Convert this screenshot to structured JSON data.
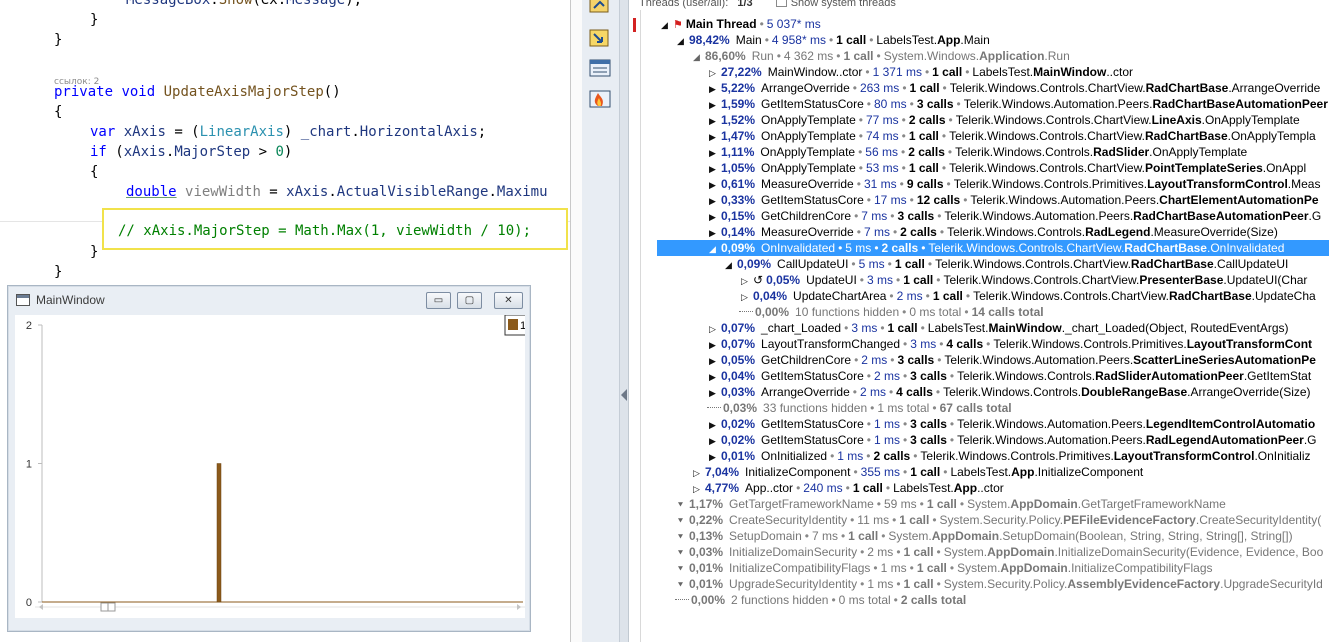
{
  "editor": {
    "lines": [
      {
        "parts": [
          {
            "c": "id",
            "t": "MessageBox"
          },
          {
            "c": "",
            "t": "."
          },
          {
            "c": "mt",
            "t": "Show"
          },
          {
            "c": "",
            "t": "(ex."
          },
          {
            "c": "id",
            "t": "Message"
          },
          {
            "c": "",
            "t": ");"
          }
        ]
      },
      {
        "parts": [
          {
            "c": "",
            "t": "}"
          }
        ]
      },
      {
        "parts": [
          {
            "c": "",
            "t": "}"
          }
        ]
      },
      {
        "parts": [
          {
            "c": "ref",
            "t": "ссылок: 2"
          }
        ]
      },
      {
        "parts": [
          {
            "c": "kw",
            "t": "private"
          },
          {
            "c": "",
            "t": " "
          },
          {
            "c": "kw",
            "t": "void"
          },
          {
            "c": "",
            "t": " "
          },
          {
            "c": "mt",
            "t": "UpdateAxisMajorStep"
          },
          {
            "c": "",
            "t": "()"
          }
        ]
      },
      {
        "parts": [
          {
            "c": "",
            "t": "{"
          }
        ]
      },
      {
        "parts": [
          {
            "c": "kw",
            "t": "var"
          },
          {
            "c": "",
            "t": " "
          },
          {
            "c": "id",
            "t": "xAxis"
          },
          {
            "c": "",
            "t": " = ("
          },
          {
            "c": "ty",
            "t": "LinearAxis"
          },
          {
            "c": "",
            "t": ") "
          },
          {
            "c": "id",
            "t": "_chart"
          },
          {
            "c": "",
            "t": "."
          },
          {
            "c": "id",
            "t": "HorizontalAxis"
          },
          {
            "c": "",
            "t": ";"
          }
        ]
      },
      {
        "parts": [
          {
            "c": "kw",
            "t": "if"
          },
          {
            "c": "",
            "t": " ("
          },
          {
            "c": "id",
            "t": "xAxis"
          },
          {
            "c": "",
            "t": "."
          },
          {
            "c": "id",
            "t": "MajorStep"
          },
          {
            "c": "",
            "t": " > "
          },
          {
            "c": "nu",
            "t": "0"
          },
          {
            "c": "",
            "t": ")"
          }
        ]
      },
      {
        "parts": [
          {
            "c": "",
            "t": "{"
          }
        ]
      },
      {
        "parts": [
          {
            "c": "kw uline",
            "t": "double"
          },
          {
            "c": "",
            "t": " "
          },
          {
            "c": "dim",
            "t": "viewWidth"
          },
          {
            "c": "",
            "t": " = "
          },
          {
            "c": "id",
            "t": "xAxis"
          },
          {
            "c": "",
            "t": "."
          },
          {
            "c": "id",
            "t": "ActualVisibleRange"
          },
          {
            "c": "",
            "t": "."
          },
          {
            "c": "id",
            "t": "Maximu"
          }
        ]
      },
      {
        "parts": [
          {
            "c": "cm",
            "t": "// xAxis.MajorStep = Math.Max(1, viewWidth / 10);"
          }
        ]
      },
      {
        "parts": [
          {
            "c": "",
            "t": "}"
          }
        ]
      },
      {
        "parts": [
          {
            "c": "",
            "t": "}"
          }
        ]
      }
    ]
  },
  "main_window": {
    "title": "MainWindow",
    "min_glyph": "▭",
    "max_glyph": "▢",
    "close_glyph": "✕",
    "legend_label": "1",
    "accent": "#8b5a1b"
  },
  "chart_data": {
    "type": "bar",
    "categories": [
      ""
    ],
    "values": [
      1
    ],
    "yticks": [
      "0",
      "1",
      "2"
    ],
    "ylim": [
      0,
      2
    ],
    "legend": [
      "1"
    ]
  },
  "profiler": {
    "threads_label": "Threads (user/all):",
    "threads_value": "1/3",
    "show_system_threads": "Show system threads",
    "main_thread": {
      "name": "Main Thread",
      "time": "5 037* ms"
    },
    "rows": [
      {
        "tog": "◢",
        "pct": "98,42%",
        "method": "Main",
        "time": "4 958* ms",
        "calls": "1 call",
        "ns": "LabelsTest.",
        "cls": "App",
        "rest": ".Main"
      },
      {
        "tog": "◢",
        "pct": "86,60%",
        "method": "Run",
        "time": "4 362 ms",
        "calls": "1 call",
        "ns": "System.Windows.",
        "cls": "Application",
        "rest": ".Run",
        "gray": true
      },
      {
        "tog": "▷",
        "pct": "27,22%",
        "method": "MainWindow..ctor",
        "time": "1 371 ms",
        "calls": "1 call",
        "ns": "LabelsTest.",
        "cls": "MainWindow",
        "rest": "..ctor"
      },
      {
        "tog": "▶",
        "pct": "5,22%",
        "method": "ArrangeOverride",
        "time": "263 ms",
        "calls": "1 call",
        "ns": "Telerik.Windows.Controls.ChartView.",
        "cls": "RadChartBase",
        "rest": ".ArrangeOverride"
      },
      {
        "tog": "▶",
        "pct": "1,59%",
        "method": "GetItemStatusCore",
        "time": "80 ms",
        "calls": "3 calls",
        "ns": "Telerik.Windows.Automation.Peers.",
        "cls": "RadChartBaseAutomationPeer",
        "rest": ""
      },
      {
        "tog": "▶",
        "pct": "1,52%",
        "method": "OnApplyTemplate",
        "time": "77 ms",
        "calls": "2 calls",
        "ns": "Telerik.Windows.Controls.ChartView.",
        "cls": "LineAxis",
        "rest": ".OnApplyTemplate"
      },
      {
        "tog": "▶",
        "pct": "1,47%",
        "method": "OnApplyTemplate",
        "time": "74 ms",
        "calls": "1 call",
        "ns": "Telerik.Windows.Controls.ChartView.",
        "cls": "RadChartBase",
        "rest": ".OnApplyTempla"
      },
      {
        "tog": "▶",
        "pct": "1,11%",
        "method": "OnApplyTemplate",
        "time": "56 ms",
        "calls": "2 calls",
        "ns": "Telerik.Windows.Controls.",
        "cls": "RadSlider",
        "rest": ".OnApplyTemplate"
      },
      {
        "tog": "▶",
        "pct": "1,05%",
        "method": "OnApplyTemplate",
        "time": "53 ms",
        "calls": "1 call",
        "ns": "Telerik.Windows.Controls.ChartView.",
        "cls": "PointTemplateSeries",
        "rest": ".OnAppl"
      },
      {
        "tog": "▶",
        "pct": "0,61%",
        "method": "MeasureOverride",
        "time": "31 ms",
        "calls": "9 calls",
        "ns": "Telerik.Windows.Controls.Primitives.",
        "cls": "LayoutTransformControl",
        "rest": ".Meas"
      },
      {
        "tog": "▶",
        "pct": "0,33%",
        "method": "GetItemStatusCore",
        "time": "17 ms",
        "calls": "12 calls",
        "ns": "Telerik.Windows.Automation.Peers.",
        "cls": "ChartElementAutomationPe",
        "rest": ""
      },
      {
        "tog": "▶",
        "pct": "0,15%",
        "method": "GetChildrenCore",
        "time": "7 ms",
        "calls": "3 calls",
        "ns": "Telerik.Windows.Automation.Peers.",
        "cls": "RadChartBaseAutomationPeer",
        "rest": ".G"
      },
      {
        "tog": "▶",
        "pct": "0,14%",
        "method": "MeasureOverride",
        "time": "7 ms",
        "calls": "2 calls",
        "ns": "Telerik.Windows.Controls.",
        "cls": "RadLegend",
        "rest": ".MeasureOverride(Size)"
      },
      {
        "tog": "◢",
        "pct": "0,09%",
        "method": "OnInvalidated",
        "time": "5 ms",
        "calls": "2 calls",
        "ns": "Telerik.Windows.Controls.ChartView.",
        "cls": "RadChartBase",
        "rest": ".OnInvalidated",
        "sel": true
      },
      {
        "tog": "◢",
        "pct": "0,09%",
        "method": "CallUpdateUI",
        "time": "5 ms",
        "calls": "1 call",
        "ns": "Telerik.Windows.Controls.ChartView.",
        "cls": "RadChartBase",
        "rest": ".CallUpdateUI"
      },
      {
        "tog": "▷",
        "pre": "↺",
        "pct": "0,05%",
        "method": "UpdateUI",
        "time": "3 ms",
        "calls": "1 call",
        "ns": "Telerik.Windows.Controls.ChartView.",
        "cls": "PresenterBase",
        "rest": ".UpdateUI(Char"
      },
      {
        "tog": "▷",
        "pct": "0,04%",
        "method": "UpdateChartArea",
        "time": "2 ms",
        "calls": "1 call",
        "ns": "Telerik.Windows.Controls.ChartView.",
        "cls": "RadChartBase",
        "rest": ".UpdateCha"
      },
      {
        "tog": "",
        "dots": true,
        "pct": "0,00%",
        "method": "10 functions hidden",
        "time": "0 ms total",
        "calls": "14 calls total",
        "gray": true
      },
      {
        "tog": "▷",
        "pct": "0,07%",
        "method": "_chart_Loaded",
        "time": "3 ms",
        "calls": "1 call",
        "ns": "LabelsTest.",
        "cls": "MainWindow",
        "rest": "._chart_Loaded(Object, RoutedEventArgs)"
      },
      {
        "tog": "▶",
        "pct": "0,07%",
        "method": "LayoutTransformChanged",
        "time": "3 ms",
        "calls": "4 calls",
        "ns": "Telerik.Windows.Controls.Primitives.",
        "cls": "LayoutTransformCont",
        "rest": ""
      },
      {
        "tog": "▶",
        "pct": "0,05%",
        "method": "GetChildrenCore",
        "time": "2 ms",
        "calls": "3 calls",
        "ns": "Telerik.Windows.Automation.Peers.",
        "cls": "ScatterLineSeriesAutomationPe",
        "rest": ""
      },
      {
        "tog": "▶",
        "pct": "0,04%",
        "method": "GetItemStatusCore",
        "time": "2 ms",
        "calls": "3 calls",
        "ns": "Telerik.Windows.Controls.",
        "cls": "RadSliderAutomationPeer",
        "rest": ".GetItemStat"
      },
      {
        "tog": "▶",
        "pct": "0,03%",
        "method": "ArrangeOverride",
        "time": "2 ms",
        "calls": "4 calls",
        "ns": "Telerik.Windows.Controls.",
        "cls": "DoubleRangeBase",
        "rest": ".ArrangeOverride(Size)"
      },
      {
        "tog": "",
        "dots": true,
        "pct": "0,03%",
        "method": "33 functions hidden",
        "time": "1 ms total",
        "calls": "67 calls total",
        "gray": true
      },
      {
        "tog": "▶",
        "pct": "0,02%",
        "method": "GetItemStatusCore",
        "time": "1 ms",
        "calls": "3 calls",
        "ns": "Telerik.Windows.Automation.Peers.",
        "cls": "LegendItemControlAutomatio",
        "rest": ""
      },
      {
        "tog": "▶",
        "pct": "0,02%",
        "method": "GetItemStatusCore",
        "time": "1 ms",
        "calls": "3 calls",
        "ns": "Telerik.Windows.Automation.Peers.",
        "cls": "RadLegendAutomationPeer",
        "rest": ".G"
      },
      {
        "tog": "▶",
        "pct": "0,01%",
        "method": "OnInitialized",
        "time": "1 ms",
        "calls": "2 calls",
        "ns": "Telerik.Windows.Controls.Primitives.",
        "cls": "LayoutTransformControl",
        "rest": ".OnInitializ"
      },
      {
        "tog": "▷",
        "pct": "7,04%",
        "method": "InitializeComponent",
        "time": "355 ms",
        "calls": "1 call",
        "ns": "LabelsTest.",
        "cls": "App",
        "rest": ".InitializeComponent"
      },
      {
        "tog": "▷",
        "pct": "4,77%",
        "method": "App..ctor",
        "time": "240 ms",
        "calls": "1 call",
        "ns": "LabelsTest.",
        "cls": "App",
        "rest": "..ctor"
      },
      {
        "tog": "⯆",
        "pct": "1,17%",
        "method": "GetTargetFrameworkName",
        "time": "59 ms",
        "calls": "1 call",
        "ns": "System.",
        "cls": "AppDomain",
        "rest": ".GetTargetFrameworkName",
        "gray": true
      },
      {
        "tog": "⯆",
        "pct": "0,22%",
        "method": "CreateSecurityIdentity",
        "time": "11 ms",
        "calls": "1 call",
        "ns": "System.Security.Policy.",
        "cls": "PEFileEvidenceFactory",
        "rest": ".CreateSecurityIdentity(",
        "gray": true
      },
      {
        "tog": "⯆",
        "pct": "0,13%",
        "method": "SetupDomain",
        "time": "7 ms",
        "calls": "1 call",
        "ns": "System.",
        "cls": "AppDomain",
        "rest": ".SetupDomain(Boolean, String, String, String[], String[])",
        "gray": true
      },
      {
        "tog": "⯆",
        "pct": "0,03%",
        "method": "InitializeDomainSecurity",
        "time": "2 ms",
        "calls": "1 call",
        "ns": "System.",
        "cls": "AppDomain",
        "rest": ".InitializeDomainSecurity(Evidence, Evidence, Boo",
        "gray": true
      },
      {
        "tog": "⯆",
        "pct": "0,01%",
        "method": "InitializeCompatibilityFlags",
        "time": "1 ms",
        "calls": "1 call",
        "ns": "System.",
        "cls": "AppDomain",
        "rest": ".InitializeCompatibilityFlags",
        "gray": true
      },
      {
        "tog": "⯆",
        "pct": "0,01%",
        "method": "UpgradeSecurityIdentity",
        "time": "1 ms",
        "calls": "1 call",
        "ns": "System.Security.Policy.",
        "cls": "AssemblyEvidenceFactory",
        "rest": ".UpgradeSecurityId",
        "gray": true
      },
      {
        "tog": "",
        "dots": true,
        "pct": "0,00%",
        "method": "2 functions hidden",
        "time": "0 ms total",
        "calls": "2 calls total",
        "gray": true
      }
    ]
  }
}
